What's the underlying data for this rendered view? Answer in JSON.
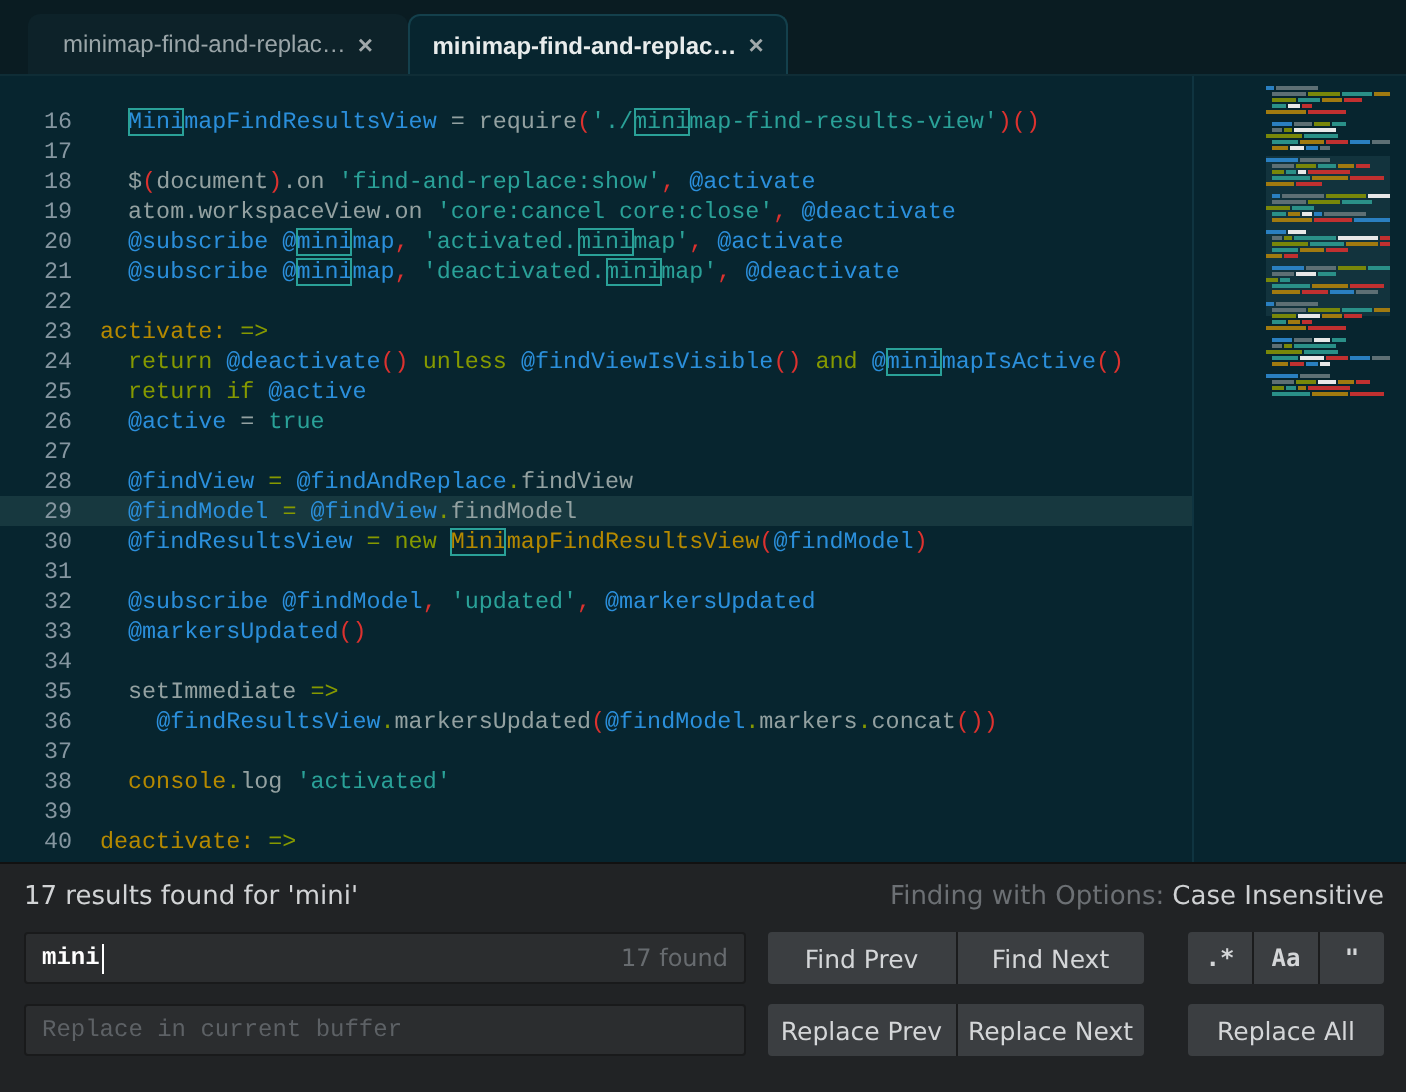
{
  "tabs": [
    {
      "label": "minimap-find-and-replac…",
      "close": "×",
      "selected": false
    },
    {
      "label": "minimap-find-and-replac…",
      "close": "×",
      "selected": true
    }
  ],
  "editor": {
    "lines": [
      {
        "number": "16",
        "cursor": false,
        "tokens": [
          {
            "text": "  Mini",
            "kind": "var",
            "match": true
          },
          {
            "text": "mapFindResultsView",
            "kind": "var"
          },
          {
            "text": " = require",
            "kind": "plain"
          },
          {
            "text": "(",
            "kind": "punct"
          },
          {
            "text": "'./",
            "kind": "str"
          },
          {
            "text": "mini",
            "kind": "str",
            "match": true
          },
          {
            "text": "map-find-results-view'",
            "kind": "str"
          },
          {
            "text": ")()",
            "kind": "punct"
          }
        ]
      },
      {
        "number": "17",
        "cursor": false
      },
      {
        "number": "18",
        "cursor": false,
        "tokens": [
          {
            "text": "  $",
            "kind": "plain"
          },
          {
            "text": "(",
            "kind": "punct"
          },
          {
            "text": "document",
            "kind": "plain"
          },
          {
            "text": ")",
            "kind": "punct"
          },
          {
            "text": ".on ",
            "kind": "plain"
          },
          {
            "text": "'find-and-replace:show'",
            "kind": "str"
          },
          {
            "text": ", ",
            "kind": "punct"
          },
          {
            "text": "@activate",
            "kind": "var"
          }
        ]
      },
      {
        "number": "19",
        "cursor": false,
        "tokens": [
          {
            "text": "  atom.workspaceView.on ",
            "kind": "plain"
          },
          {
            "text": "'core:cancel core:close'",
            "kind": "str"
          },
          {
            "text": ", ",
            "kind": "punct"
          },
          {
            "text": "@deactivate",
            "kind": "var"
          }
        ]
      },
      {
        "number": "20",
        "cursor": false,
        "tokens": [
          {
            "text": "  @subscribe @",
            "kind": "var"
          },
          {
            "text": "mini",
            "kind": "var",
            "match": true
          },
          {
            "text": "map",
            "kind": "var"
          },
          {
            "text": ", ",
            "kind": "punct"
          },
          {
            "text": "'activated.",
            "kind": "str"
          },
          {
            "text": "mini",
            "kind": "str",
            "match": true
          },
          {
            "text": "map'",
            "kind": "str"
          },
          {
            "text": ", ",
            "kind": "punct"
          },
          {
            "text": "@activate",
            "kind": "var"
          }
        ]
      },
      {
        "number": "21",
        "cursor": false,
        "tokens": [
          {
            "text": "  @subscribe @",
            "kind": "var"
          },
          {
            "text": "mini",
            "kind": "var",
            "match": true
          },
          {
            "text": "map",
            "kind": "var"
          },
          {
            "text": ", ",
            "kind": "punct"
          },
          {
            "text": "'deactivated.",
            "kind": "str"
          },
          {
            "text": "mini",
            "kind": "str",
            "match": true
          },
          {
            "text": "map'",
            "kind": "str"
          },
          {
            "text": ", ",
            "kind": "punct"
          },
          {
            "text": "@deactivate",
            "kind": "var"
          }
        ]
      },
      {
        "number": "22",
        "cursor": false
      },
      {
        "number": "23",
        "cursor": false,
        "tokens": [
          {
            "text": "activate:",
            "kind": "fn"
          },
          {
            "text": " =>",
            "kind": "kw"
          }
        ]
      },
      {
        "number": "24",
        "cursor": false,
        "tokens": [
          {
            "text": "  return ",
            "kind": "kw"
          },
          {
            "text": "@deactivate",
            "kind": "var"
          },
          {
            "text": "()",
            "kind": "punct"
          },
          {
            "text": " unless ",
            "kind": "kw"
          },
          {
            "text": "@findViewIsVisible",
            "kind": "var"
          },
          {
            "text": "()",
            "kind": "punct"
          },
          {
            "text": " and ",
            "kind": "kw"
          },
          {
            "text": "@",
            "kind": "var"
          },
          {
            "text": "mini",
            "kind": "var",
            "match": true
          },
          {
            "text": "mapIsActive",
            "kind": "var"
          },
          {
            "text": "()",
            "kind": "punct"
          }
        ]
      },
      {
        "number": "25",
        "cursor": false,
        "tokens": [
          {
            "text": "  return if ",
            "kind": "kw"
          },
          {
            "text": "@active",
            "kind": "var"
          }
        ]
      },
      {
        "number": "26",
        "cursor": false,
        "tokens": [
          {
            "text": "  @active",
            "kind": "var"
          },
          {
            "text": " = ",
            "kind": "plain"
          },
          {
            "text": "true",
            "kind": "str"
          }
        ]
      },
      {
        "number": "27",
        "cursor": false
      },
      {
        "number": "28",
        "cursor": false,
        "tokens": [
          {
            "text": "  @findView",
            "kind": "var"
          },
          {
            "text": " = ",
            "kind": "kw"
          },
          {
            "text": "@findAndReplace",
            "kind": "var"
          },
          {
            "text": ".",
            "kind": "kw"
          },
          {
            "text": "findView",
            "kind": "plain"
          }
        ]
      },
      {
        "number": "29",
        "cursor": true,
        "tokens": [
          {
            "text": "  @findModel",
            "kind": "var"
          },
          {
            "text": " = ",
            "kind": "kw"
          },
          {
            "text": "@findView",
            "kind": "var"
          },
          {
            "text": ".",
            "kind": "kw"
          },
          {
            "text": "findModel",
            "kind": "plain"
          }
        ]
      },
      {
        "number": "30",
        "cursor": false,
        "tokens": [
          {
            "text": "  @findResultsView",
            "kind": "var"
          },
          {
            "text": " = new ",
            "kind": "kw"
          },
          {
            "text": "Mini",
            "kind": "fn",
            "match": true
          },
          {
            "text": "mapFindResultsView",
            "kind": "fn"
          },
          {
            "text": "(",
            "kind": "punct"
          },
          {
            "text": "@findModel",
            "kind": "var"
          },
          {
            "text": ")",
            "kind": "punct"
          }
        ]
      },
      {
        "number": "31",
        "cursor": false
      },
      {
        "number": "32",
        "cursor": false,
        "tokens": [
          {
            "text": "  @subscribe @findModel",
            "kind": "var"
          },
          {
            "text": ", ",
            "kind": "punct"
          },
          {
            "text": "'updated'",
            "kind": "str"
          },
          {
            "text": ", ",
            "kind": "punct"
          },
          {
            "text": "@markersUpdated",
            "kind": "var"
          }
        ]
      },
      {
        "number": "33",
        "cursor": false,
        "tokens": [
          {
            "text": "  @markersUpdated",
            "kind": "var"
          },
          {
            "text": "()",
            "kind": "punct"
          }
        ]
      },
      {
        "number": "34",
        "cursor": false
      },
      {
        "number": "35",
        "cursor": false,
        "tokens": [
          {
            "text": "  setImmediate ",
            "kind": "plain"
          },
          {
            "text": "=>",
            "kind": "kw"
          }
        ]
      },
      {
        "number": "36",
        "cursor": false,
        "tokens": [
          {
            "text": "    @findResultsView",
            "kind": "var"
          },
          {
            "text": ".",
            "kind": "kw"
          },
          {
            "text": "markersUpdated",
            "kind": "plain"
          },
          {
            "text": "(",
            "kind": "punct"
          },
          {
            "text": "@findModel",
            "kind": "var"
          },
          {
            "text": ".",
            "kind": "kw"
          },
          {
            "text": "markers",
            "kind": "plain"
          },
          {
            "text": ".",
            "kind": "kw"
          },
          {
            "text": "concat",
            "kind": "plain"
          },
          {
            "text": "())",
            "kind": "punct"
          }
        ]
      },
      {
        "number": "37",
        "cursor": false
      },
      {
        "number": "38",
        "cursor": false,
        "tokens": [
          {
            "text": "  console",
            "kind": "fn"
          },
          {
            "text": ".",
            "kind": "kw"
          },
          {
            "text": "log ",
            "kind": "plain"
          },
          {
            "text": "'activated'",
            "kind": "str"
          }
        ]
      },
      {
        "number": "39",
        "cursor": false
      },
      {
        "number": "40",
        "cursor": false,
        "tokens": [
          {
            "text": "deactivate:",
            "kind": "fn"
          },
          {
            "text": " =>",
            "kind": "kw"
          }
        ]
      }
    ]
  },
  "find_panel": {
    "message": "17 results found for 'mini'",
    "options_label": "Finding with Options:",
    "options_value": "Case Insensitive",
    "find_field": {
      "value": "mini",
      "count": "17 found"
    },
    "find_buttons": [
      "Find Prev",
      "Find Next"
    ],
    "option_toggles": [
      {
        "label": ".*",
        "on": false
      },
      {
        "label": "Aa",
        "on": false
      },
      {
        "label": "\"",
        "on": false
      }
    ],
    "replace_field": {
      "placeholder": "Replace in current buffer"
    },
    "replace_buttons": [
      "Replace Prev",
      "Replace Next"
    ],
    "replace_all": "Replace All"
  }
}
